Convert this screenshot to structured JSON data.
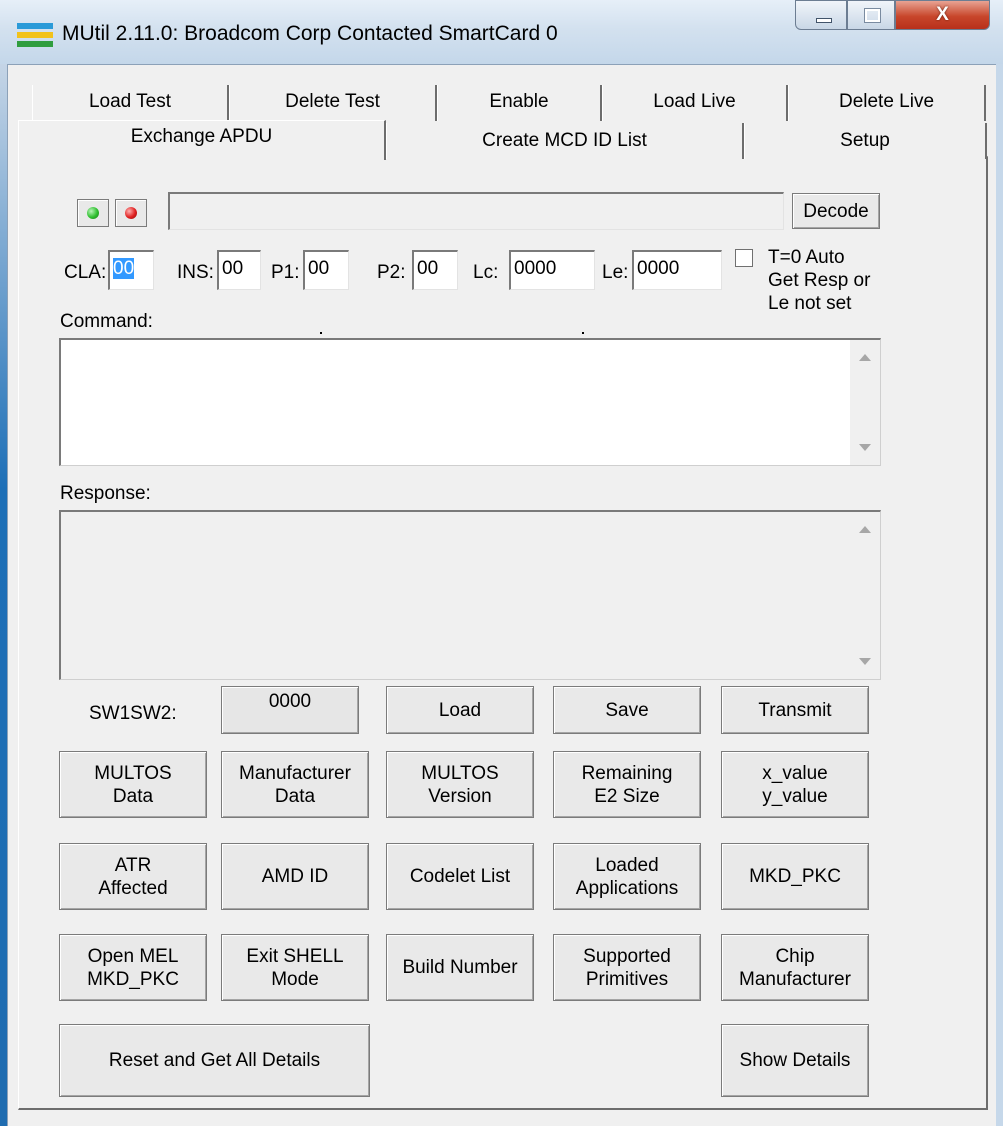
{
  "window": {
    "title": "MUtil 2.11.0: Broadcom Corp Contacted SmartCard 0",
    "close_glyph": "X"
  },
  "tabs": {
    "row1": [
      "Load Test",
      "Delete Test",
      "Enable",
      "Load Live",
      "Delete Live"
    ],
    "row2": [
      "Exchange APDU",
      "Create MCD ID List",
      "Setup"
    ],
    "active": "Exchange APDU"
  },
  "apdu": {
    "decode_label": "Decode",
    "cla_label": "CLA:",
    "cla_value": "00",
    "ins_label": "INS:",
    "ins_value": "00",
    "p1_label": "P1:",
    "p1_value": "00",
    "p2_label": "P2:",
    "p2_value": "00",
    "lc_label": "Lc:",
    "lc_value": "0000",
    "le_label": "Le:",
    "le_value": "0000",
    "t0_label": "T=0 Auto\nGet Resp or\nLe not set",
    "t0_checked": false,
    "command_label": "Command:",
    "response_label": "Response:",
    "sw_label": "SW1SW2:",
    "sw_value": "0000"
  },
  "buttons": {
    "load": "Load",
    "save": "Save",
    "transmit": "Transmit",
    "multos_data": "MULTOS\nData",
    "manufacturer_data": "Manufacturer\nData",
    "multos_version": "MULTOS\nVersion",
    "remaining_e2": "Remaining\nE2 Size",
    "xy_value": "x_value\ny_value",
    "atr_affected": "ATR\nAffected",
    "amd_id": "AMD ID",
    "codelet_list": "Codelet List",
    "loaded_apps": "Loaded\nApplications",
    "mkd_pkc": "MKD_PKC",
    "open_mel": "Open MEL\nMKD_PKC",
    "exit_shell": "Exit SHELL\nMode",
    "build_number": "Build Number",
    "supported_primitives": "Supported\nPrimitives",
    "chip_manufacturer": "Chip\nManufacturer",
    "reset_all": "Reset and Get All Details",
    "show_details": "Show Details"
  },
  "icons": {
    "green_led": "green-led-icon",
    "red_led": "red-led-icon"
  },
  "colors": {
    "green_led": "#2fbf2f",
    "red_led": "#e02020",
    "selection": "#3399ff"
  }
}
